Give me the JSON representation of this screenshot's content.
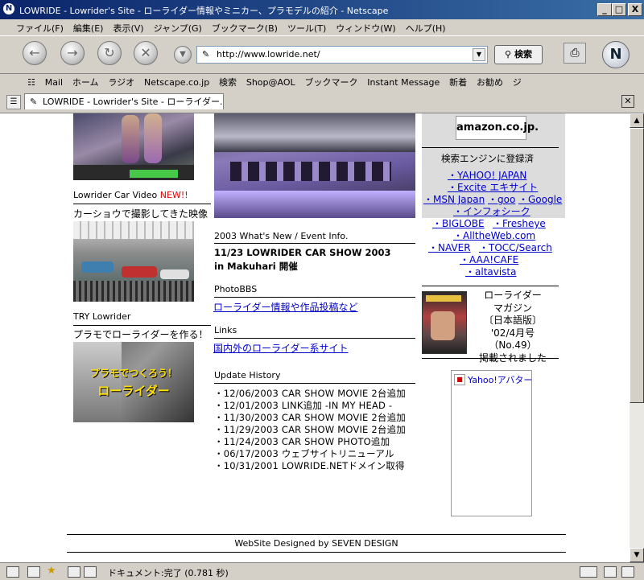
{
  "window": {
    "title": "LOWRIDE - Lowrider's Site - ローライダー情報やミニカー、プラモデルの紹介 - Netscape",
    "controls": {
      "minimize": "_",
      "maximize": "□",
      "close": "X"
    }
  },
  "menu": [
    "ファイル(F)",
    "編集(E)",
    "表示(V)",
    "ジャンプ(G)",
    "ブックマーク(B)",
    "ツール(T)",
    "ウィンドウ(W)",
    "ヘルプ(H)"
  ],
  "nav": {
    "url": "http://www.lowride.net/",
    "search_label": "検索",
    "logo": "N"
  },
  "personal_toolbar": [
    "Mail",
    "ホーム",
    "ラジオ",
    "Netscape.co.jp",
    "検索",
    "Shop@AOL",
    "ブックマーク",
    "Instant Message",
    "新着",
    "お勧め",
    "ジ"
  ],
  "tab": {
    "title": "LOWRIDE - Lowrider's Site - ローライダー..."
  },
  "left": {
    "video_title": "Lowrider Car Video",
    "video_new": "NEW!!",
    "video_caption": "カーショウで撮影してきた映像",
    "try_title": "TRY Lowrider",
    "try_caption": "プラモでローライダーを作る！",
    "banner_line1": "プラモでつくろう！",
    "banner_line2": "ローライダー"
  },
  "center": {
    "whatsnew_title": "2003 What's New / Event Info.",
    "event_line1": "11/23  LOWRIDER CAR SHOW 2003",
    "event_line2": "in Makuhari 開催",
    "photobbs_title": "PhotoBBS",
    "photobbs_link": "ローライダー情報や作品投稿など",
    "links_title": "Links",
    "links_link": "国内外のローライダー系サイト",
    "update_title": "Update History",
    "updates": [
      "・12/06/2003  CAR SHOW MOVIE 2台追加",
      "・12/01/2003  LINK追加 -IN MY HEAD -",
      "・11/30/2003  CAR SHOW MOVIE 2台追加",
      "・11/29/2003  CAR SHOW MOVIE 2台追加",
      "・11/24/2003  CAR SHOW PHOTO追加",
      "・06/17/2003  ウェブサイトリニューアル",
      "・10/31/2001  LOWRIDE.NETドメイン取得"
    ]
  },
  "right": {
    "amazon": "amazon.co.jp.",
    "search_heading": "検索エンジンに登録済",
    "engines": [
      "・YAHOO! JAPAN",
      "・Excite エキサイト",
      "・MSN Japan",
      "・goo",
      "・Google",
      "・インフォシーク",
      "・BIGLOBE",
      "・Fresheye",
      "・AlltheWeb.com",
      "・NAVER",
      "・TOCC/Search",
      "・AAA!CAFE",
      "・altavista"
    ],
    "magazine_lines": [
      "ローライダー",
      "マガジン",
      "〔日本語版〕",
      "'02/4月号（No.49）",
      "掲載されました"
    ],
    "avatar_label": "Yahoo!アバター"
  },
  "footer": {
    "credit": "WebSite Designed by SEVEN DESIGN"
  },
  "status": {
    "text": "ドキュメント:完了 (0.781 秒)"
  }
}
